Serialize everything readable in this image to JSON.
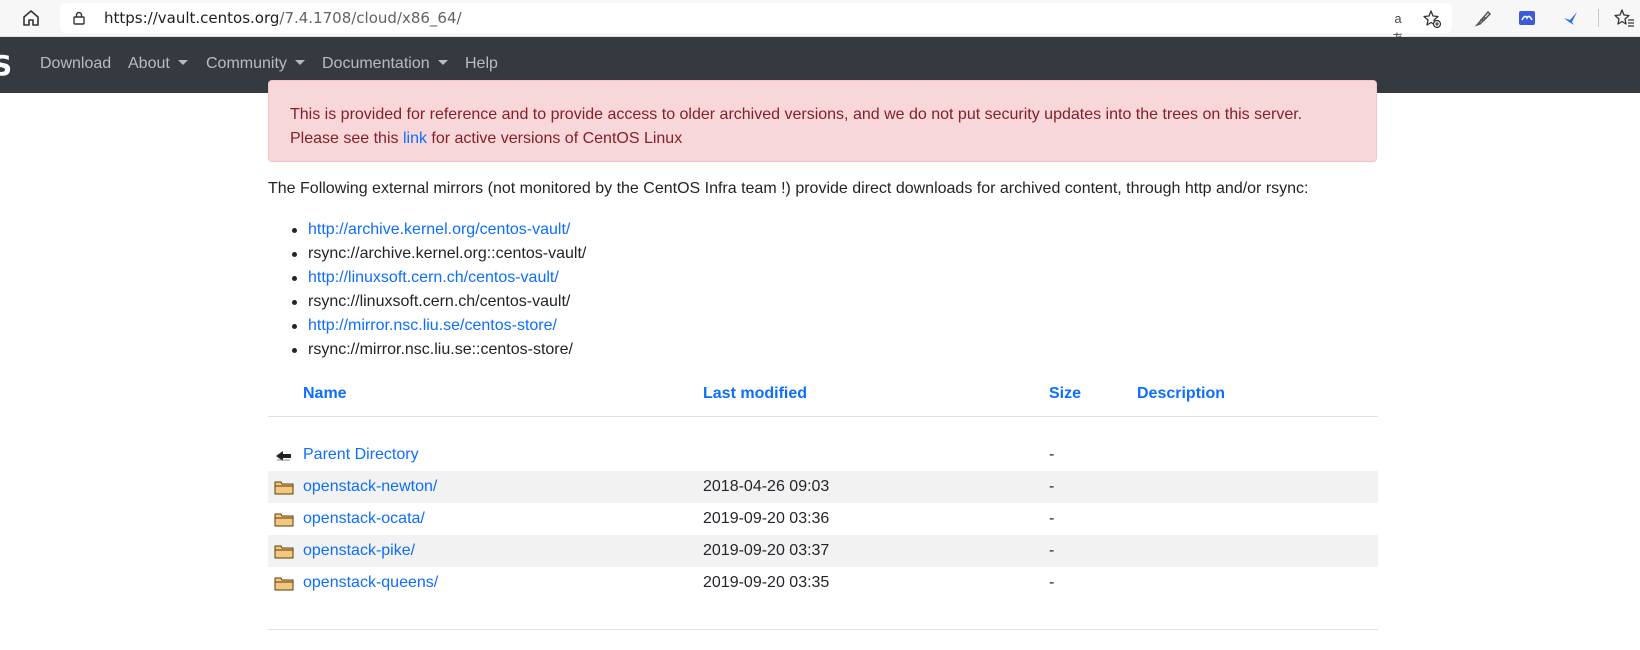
{
  "browser": {
    "url_host": "https://vault.centos.org",
    "url_path": "/7.4.1708/cloud/x86_64/",
    "translate_icon": "aあ"
  },
  "navbar": {
    "brand": "S",
    "items": [
      {
        "label": "Download",
        "dropdown": false
      },
      {
        "label": "About",
        "dropdown": true
      },
      {
        "label": "Community",
        "dropdown": true
      },
      {
        "label": "Documentation",
        "dropdown": true
      },
      {
        "label": "Help",
        "dropdown": false
      }
    ]
  },
  "alert": {
    "line1": "This is provided for reference and to provide access to older archived versions, and we do not put security updates into the trees on this server.",
    "line2_prefix": "Please see this ",
    "line2_link": "link",
    "line2_suffix": " for active versions of CentOS Linux"
  },
  "mirrors": {
    "intro": "The Following external mirrors (not monitored by the CentOS Infra team !) provide direct downloads for archived content, through http and/or rsync:",
    "items": [
      {
        "text": "http://archive.kernel.org/centos-vault/",
        "link": true
      },
      {
        "text": "rsync://archive.kernel.org::centos-vault/",
        "link": false
      },
      {
        "text": "http://linuxsoft.cern.ch/centos-vault/",
        "link": true
      },
      {
        "text": "rsync://linuxsoft.cern.ch/centos-vault/",
        "link": false
      },
      {
        "text": "http://mirror.nsc.liu.se/centos-store/",
        "link": true
      },
      {
        "text": "rsync://mirror.nsc.liu.se::centos-store/",
        "link": false
      }
    ]
  },
  "listing": {
    "headers": {
      "name": "Name",
      "modified": "Last modified",
      "size": "Size",
      "description": "Description"
    },
    "rows": [
      {
        "name": "Parent Directory",
        "modified": "",
        "size": "-",
        "icon": "parent-directory-icon"
      },
      {
        "name": "openstack-newton/",
        "modified": "2018-04-26 09:03",
        "size": "-",
        "icon": "folder-icon"
      },
      {
        "name": "openstack-ocata/",
        "modified": "2019-09-20 03:36",
        "size": "-",
        "icon": "folder-icon"
      },
      {
        "name": "openstack-pike/",
        "modified": "2019-09-20 03:37",
        "size": "-",
        "icon": "folder-icon"
      },
      {
        "name": "openstack-queens/",
        "modified": "2019-09-20 03:35",
        "size": "-",
        "icon": "folder-icon"
      }
    ]
  }
}
